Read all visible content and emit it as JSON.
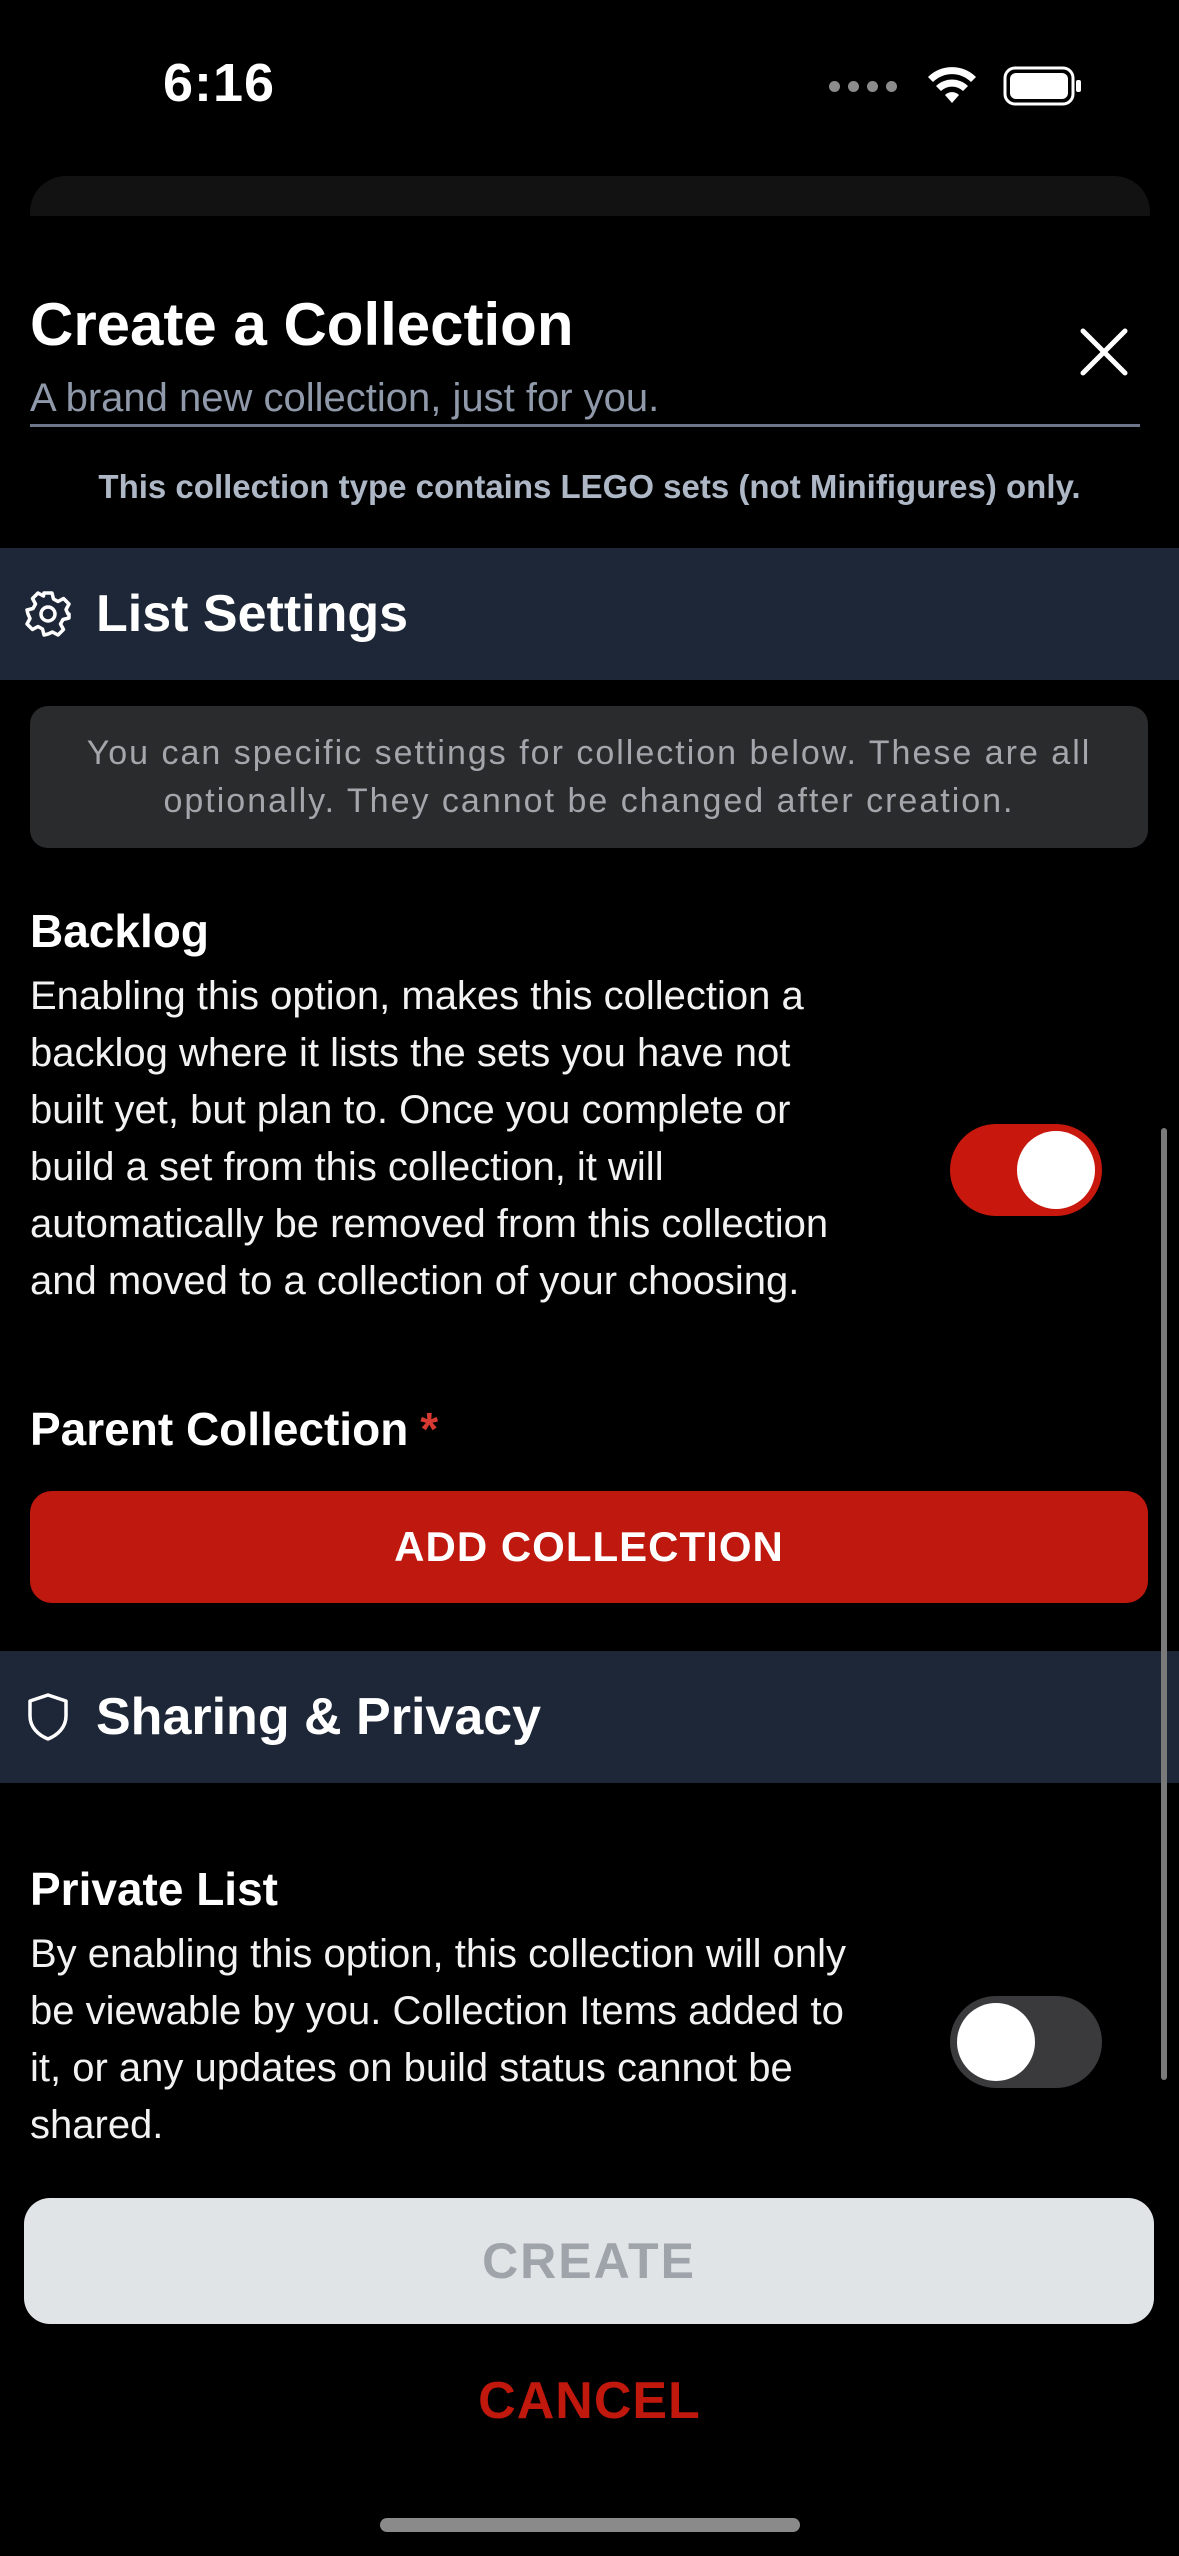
{
  "status_bar": {
    "time": "6:16"
  },
  "modal": {
    "title": "Create a Collection",
    "subtitle_placeholder": "A brand new collection, just for you.",
    "type_note": "This collection type contains LEGO sets (not Minifigures) only."
  },
  "list_settings": {
    "header": "List Settings",
    "info": "You can specific settings for collection below. These are all optionally. They cannot be changed after creation.",
    "backlog": {
      "title": "Backlog",
      "description": "Enabling this option, makes this collection a backlog where it lists the sets you have not built yet, but plan to. Once you complete or build a set from this collection, it will automatically be removed from this collection and moved to a collection of your choosing.",
      "enabled": true
    },
    "parent_collection": {
      "label": "Parent Collection",
      "required_marker": "*",
      "button_label": "ADD COLLECTION"
    }
  },
  "sharing_privacy": {
    "header": "Sharing & Privacy",
    "private_list": {
      "title": "Private List",
      "description": "By enabling this option, this collection will only be viewable by you. Collection Items added to it, or any updates on build status cannot be shared.",
      "enabled": false
    }
  },
  "actions": {
    "create_label": "CREATE",
    "cancel_label": "CANCEL"
  },
  "colors": {
    "accent_red": "#bf180e",
    "section_header_bg": "#1d2737",
    "toggle_on": "#c8180e",
    "toggle_off": "#3a3a3c"
  },
  "icons": {
    "close": "close-icon",
    "settings": "gear-icon",
    "privacy": "shield-icon",
    "wifi": "wifi-icon",
    "battery": "battery-icon"
  }
}
